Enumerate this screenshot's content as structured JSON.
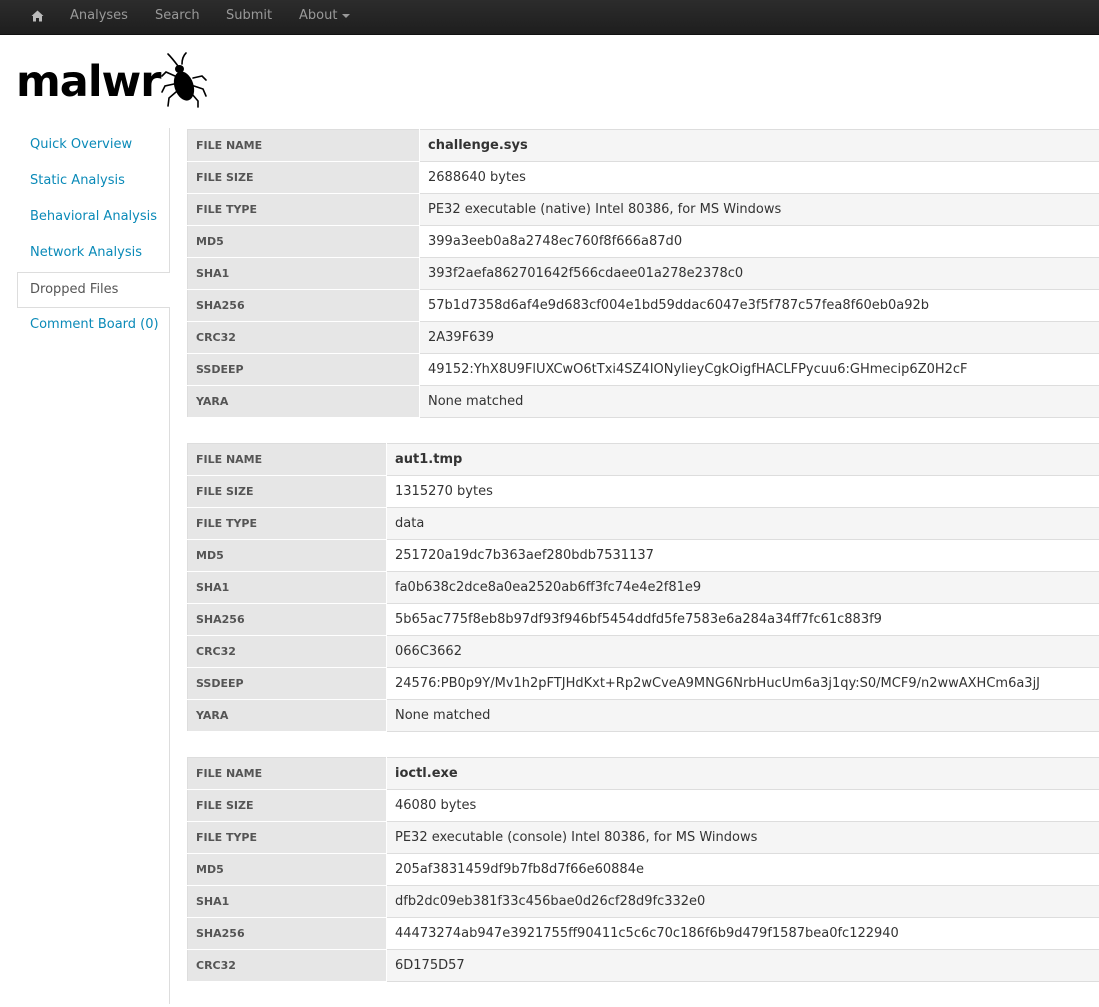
{
  "navbar": {
    "home_icon": "home-icon",
    "items": [
      {
        "label": "Analyses"
      },
      {
        "label": "Search"
      },
      {
        "label": "Submit"
      },
      {
        "label": "About"
      }
    ]
  },
  "logo": {
    "text": "malwr",
    "icon": "bug-icon"
  },
  "sidebar": {
    "items": [
      {
        "label": "Quick Overview"
      },
      {
        "label": "Static Analysis"
      },
      {
        "label": "Behavioral Analysis"
      },
      {
        "label": "Network Analysis"
      },
      {
        "label": "Dropped Files"
      },
      {
        "label": "Comment Board (0)"
      }
    ],
    "active": "Dropped Files"
  },
  "files": [
    {
      "rows": [
        {
          "key": "FILE NAME",
          "value": "challenge.sys"
        },
        {
          "key": "FILE SIZE",
          "value": "2688640 bytes"
        },
        {
          "key": "FILE TYPE",
          "value": "PE32 executable (native) Intel 80386, for MS Windows"
        },
        {
          "key": "MD5",
          "value": "399a3eeb0a8a2748ec760f8f666a87d0"
        },
        {
          "key": "SHA1",
          "value": "393f2aefa862701642f566cdaee01a278e2378c0"
        },
        {
          "key": "SHA256",
          "value": "57b1d7358d6af4e9d683cf004e1bd59ddac6047e3f5f787c57fea8f60eb0a92b"
        },
        {
          "key": "CRC32",
          "value": "2A39F639"
        },
        {
          "key": "SSDEEP",
          "value": "49152:YhX8U9FlUXCwO6tTxi4SZ4IONyIieyCgkOigfHACLFPycuu6:GHmecip6Z0H2cF"
        },
        {
          "key": "YARA",
          "value": "None matched"
        }
      ]
    },
    {
      "rows": [
        {
          "key": "FILE NAME",
          "value": "aut1.tmp"
        },
        {
          "key": "FILE SIZE",
          "value": "1315270 bytes"
        },
        {
          "key": "FILE TYPE",
          "value": "data"
        },
        {
          "key": "MD5",
          "value": "251720a19dc7b363aef280bdb7531137"
        },
        {
          "key": "SHA1",
          "value": "fa0b638c2dce8a0ea2520ab6ff3fc74e4e2f81e9"
        },
        {
          "key": "SHA256",
          "value": "5b65ac775f8eb8b97df93f946bf5454ddfd5fe7583e6a284a34ff7fc61c883f9"
        },
        {
          "key": "CRC32",
          "value": "066C3662"
        },
        {
          "key": "SSDEEP",
          "value": "24576:PB0p9Y/Mv1h2pFTJHdKxt+Rp2wCveA9MNG6NrbHucUm6a3j1qy:S0/MCF9/n2wwAXHCm6a3jJ"
        },
        {
          "key": "YARA",
          "value": "None matched"
        }
      ]
    },
    {
      "rows": [
        {
          "key": "FILE NAME",
          "value": "ioctl.exe"
        },
        {
          "key": "FILE SIZE",
          "value": "46080 bytes"
        },
        {
          "key": "FILE TYPE",
          "value": "PE32 executable (console) Intel 80386, for MS Windows"
        },
        {
          "key": "MD5",
          "value": "205af3831459df9b7fb8d7f66e60884e"
        },
        {
          "key": "SHA1",
          "value": "dfb2dc09eb381f33c456bae0d26cf28d9fc332e0"
        },
        {
          "key": "SHA256",
          "value": "44473274ab947e3921755ff90411c5c6c70c186f6b9d479f1587bea0fc122940"
        },
        {
          "key": "CRC32",
          "value": "6D175D57"
        }
      ]
    }
  ]
}
